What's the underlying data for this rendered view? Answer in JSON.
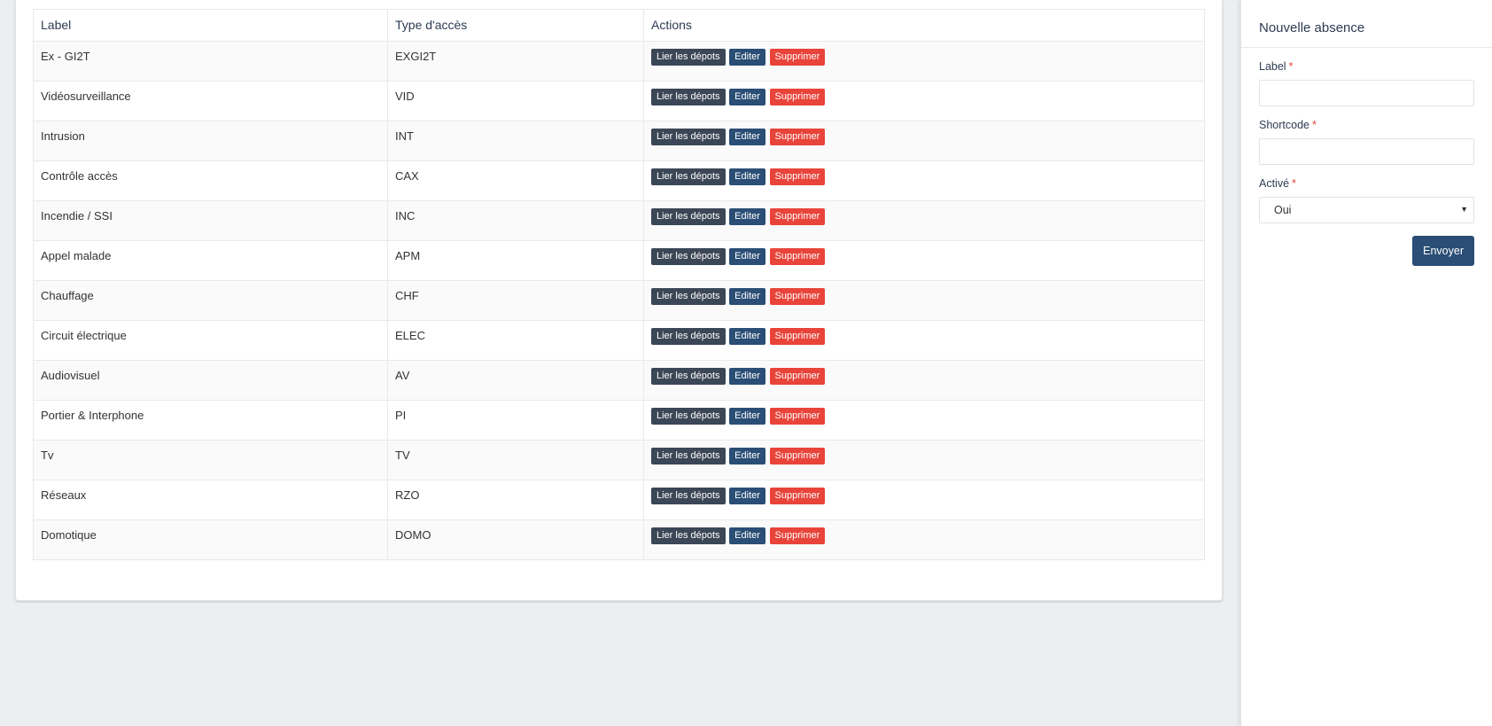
{
  "table": {
    "headers": {
      "label": "Label",
      "type": "Type d'accès",
      "actions": "Actions"
    },
    "rows": [
      {
        "label": "Ex - GI2T",
        "type": "EXGI2T"
      },
      {
        "label": "Vidéosurveillance",
        "type": "VID"
      },
      {
        "label": "Intrusion",
        "type": "INT"
      },
      {
        "label": "Contrôle accès",
        "type": "CAX"
      },
      {
        "label": "Incendie / SSI",
        "type": "INC"
      },
      {
        "label": "Appel malade",
        "type": "APM"
      },
      {
        "label": "Chauffage",
        "type": "CHF"
      },
      {
        "label": "Circuit électrique",
        "type": "ELEC"
      },
      {
        "label": "Audiovisuel",
        "type": "AV"
      },
      {
        "label": "Portier & Interphone",
        "type": "PI"
      },
      {
        "label": "Tv",
        "type": "TV"
      },
      {
        "label": "Réseaux",
        "type": "RZO"
      },
      {
        "label": "Domotique",
        "type": "DOMO"
      }
    ],
    "action_labels": {
      "link": "Lier les dépots",
      "edit": "Editer",
      "delete": "Supprimer"
    }
  },
  "panel": {
    "title": "Nouvelle absence",
    "fields": {
      "label": {
        "label": "Label",
        "required_mark": "*",
        "value": ""
      },
      "shortcode": {
        "label": "Shortcode",
        "required_mark": "*",
        "value": ""
      },
      "active": {
        "label": "Activé",
        "required_mark": "*",
        "selected": "Oui"
      }
    },
    "submit_label": "Envoyer"
  },
  "colors": {
    "background": "#eceef2",
    "btn_dark": "#3b4656",
    "btn_blue": "#2a4e75",
    "btn_red": "#e8443a"
  }
}
